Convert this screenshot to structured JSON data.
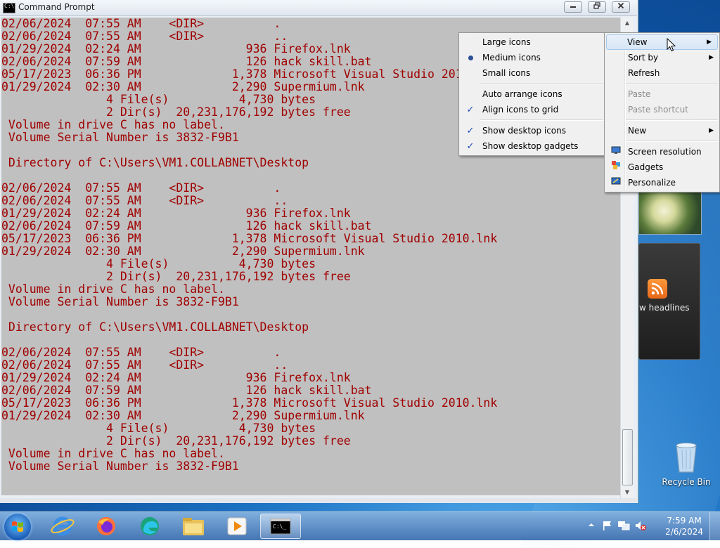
{
  "window": {
    "title": "Command Prompt"
  },
  "console_lines": [
    "02/06/2024  07:55 AM    <DIR>          .",
    "02/06/2024  07:55 AM    <DIR>          ..",
    "01/29/2024  02:24 AM               936 Firefox.lnk",
    "02/06/2024  07:59 AM               126 hack skill.bat",
    "05/17/2023  06:36 PM             1,378 Microsoft Visual Studio 2010.lnk",
    "01/29/2024  02:30 AM             2,290 Supermium.lnk",
    "               4 File(s)          4,730 bytes",
    "               2 Dir(s)  20,231,176,192 bytes free",
    " Volume in drive C has no label.",
    " Volume Serial Number is 3832-F9B1",
    "",
    " Directory of C:\\Users\\VM1.COLLABNET\\Desktop",
    "",
    "02/06/2024  07:55 AM    <DIR>          .",
    "02/06/2024  07:55 AM    <DIR>          ..",
    "01/29/2024  02:24 AM               936 Firefox.lnk",
    "02/06/2024  07:59 AM               126 hack skill.bat",
    "05/17/2023  06:36 PM             1,378 Microsoft Visual Studio 2010.lnk",
    "01/29/2024  02:30 AM             2,290 Supermium.lnk",
    "               4 File(s)          4,730 bytes",
    "               2 Dir(s)  20,231,176,192 bytes free",
    " Volume in drive C has no label.",
    " Volume Serial Number is 3832-F9B1",
    "",
    " Directory of C:\\Users\\VM1.COLLABNET\\Desktop",
    "",
    "02/06/2024  07:55 AM    <DIR>          .",
    "02/06/2024  07:55 AM    <DIR>          ..",
    "01/29/2024  02:24 AM               936 Firefox.lnk",
    "02/06/2024  07:59 AM               126 hack skill.bat",
    "05/17/2023  06:36 PM             1,378 Microsoft Visual Studio 2010.lnk",
    "01/29/2024  02:30 AM             2,290 Supermium.lnk",
    "               4 File(s)          4,730 bytes",
    "               2 Dir(s)  20,231,176,192 bytes free",
    " Volume in drive C has no label.",
    " Volume Serial Number is 3832-F9B1"
  ],
  "context_menu": {
    "items": [
      {
        "label": "View",
        "submenu": true,
        "highlighted": true
      },
      {
        "label": "Sort by",
        "submenu": true
      },
      {
        "label": "Refresh"
      },
      {
        "label": "Paste",
        "disabled": true
      },
      {
        "label": "Paste shortcut",
        "disabled": true
      },
      {
        "label": "New",
        "submenu": true
      },
      {
        "label": "Screen resolution",
        "icon": "monitor-icon"
      },
      {
        "label": "Gadgets",
        "icon": "gadgets-icon"
      },
      {
        "label": "Personalize",
        "icon": "personalize-icon"
      }
    ]
  },
  "view_submenu": {
    "items": [
      {
        "label": "Large icons",
        "state": "none"
      },
      {
        "label": "Medium icons",
        "state": "radio"
      },
      {
        "label": "Small icons",
        "state": "none"
      },
      {
        "label": "Auto arrange icons",
        "state": "none"
      },
      {
        "label": "Align icons to grid",
        "state": "check"
      },
      {
        "label": "Show desktop icons",
        "state": "check"
      },
      {
        "label": "Show desktop gadgets",
        "state": "check"
      }
    ]
  },
  "gadgets": {
    "feed_text": "w headlines"
  },
  "desktop": {
    "recycle_bin_label": "Recycle Bin"
  },
  "taskbar": {
    "pinned": [
      "internet-explorer-icon",
      "firefox-icon",
      "edge-icon",
      "file-explorer-icon",
      "media-player-icon",
      "command-prompt-icon"
    ],
    "clock_time": "7:59 AM",
    "clock_date": "2/6/2024"
  }
}
